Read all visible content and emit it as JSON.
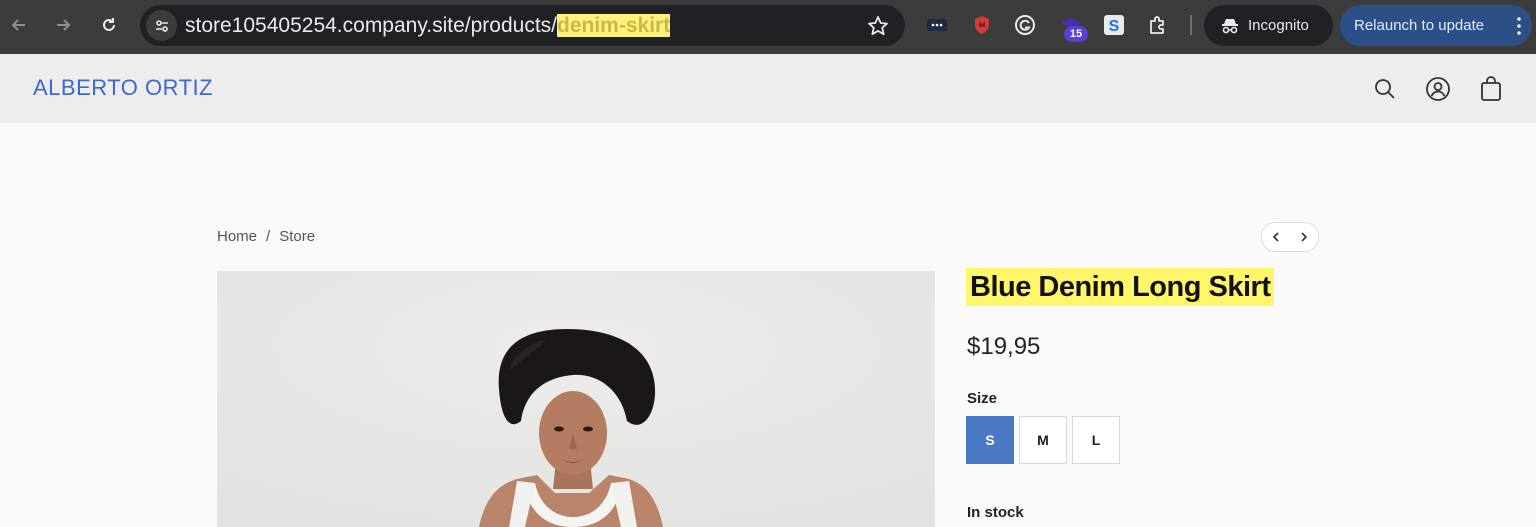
{
  "browser": {
    "url_prefix": "store105405254.company.site/products/",
    "url_highlight": "denim-skirt",
    "extension_badge": "15",
    "incognito_label": "Incognito",
    "relaunch_label": "Relaunch to update"
  },
  "store": {
    "brand": "ALBERTO ORTIZ"
  },
  "breadcrumb": {
    "home": "Home",
    "separator": "/",
    "store": "Store"
  },
  "product": {
    "title": "Blue Denim Long Skirt",
    "price": "$19,95",
    "size_label": "Size",
    "sizes": [
      "S",
      "M",
      "L"
    ],
    "selected_size": "S",
    "stock": "In stock"
  },
  "colors": {
    "brand": "#3f67d4",
    "selected_size": "#4a78c4",
    "highlight": "#fff66a"
  }
}
